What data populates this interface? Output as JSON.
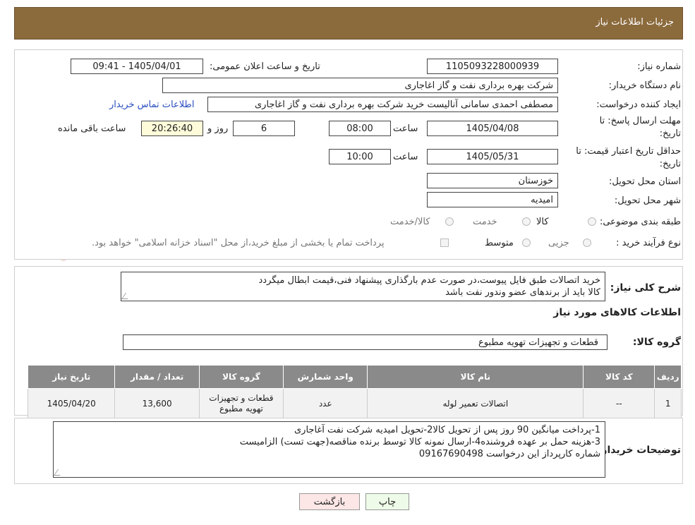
{
  "header": {
    "title": "جزئیات اطلاعات نیاز"
  },
  "form": {
    "need_number_label": "شماره نیاز:",
    "need_number": "1105093228000939",
    "announce_label": "تاریخ و ساعت اعلان عمومی:",
    "announce_value": "1405/04/01 - 09:41",
    "buyer_org_label": "نام دستگاه خریدار:",
    "buyer_org": "شرکت بهره برداری نفت و گاز اغاجاری",
    "creator_label": "ایجاد کننده درخواست:",
    "creator": "مصطفی احمدی سامانی آنالیست خرید شرکت بهره برداری نفت و گاز اغاجاری",
    "contact_link": "اطلاعات تماس خریدار",
    "deadline_label_1": "مهلت ارسال پاسخ: تا",
    "deadline_label_2": "تاریخ:",
    "deadline_date": "1405/04/08",
    "hour_label": "ساعت",
    "deadline_time": "08:00",
    "days": "6",
    "days_label": "روز و",
    "remaining": "20:26:40",
    "remaining_label": "ساعت باقی مانده",
    "validity_label_1": "حداقل تاریخ اعتبار قیمت: تا",
    "validity_label_2": "تاریخ:",
    "validity_date": "1405/05/31",
    "validity_time": "10:00",
    "province_label": "استان محل تحویل:",
    "province": "خوزستان",
    "city_label": "شهر محل تحویل:",
    "city": "امیدیه",
    "category_label": "طبقه بندی موضوعی:",
    "category_options": [
      "کالا",
      "خدمت",
      "کالا/خدمت"
    ],
    "process_label": "نوع فرآیند خرید :",
    "process_options": [
      "جزیی",
      "متوسط"
    ],
    "payment_note": "پرداخت تمام یا بخشی از مبلغ خرید،از محل \"اسناد خزانه اسلامی\" خواهد بود."
  },
  "description": {
    "label": "شرح کلی نیاز:",
    "lines": [
      "خرید اتصالات طبق فایل پیوست،در صورت عدم بارگذاری پیشنهاد فنی،قیمت ابطال میگردد",
      "کالا باید از برندهای عضو وندور نفت باشد"
    ]
  },
  "goods_info_title": "اطلاعات کالاهای مورد نیاز",
  "goods_group": {
    "label": "گروه کالا:",
    "value": "قطعات و تجهیزات تهویه مطبوع"
  },
  "table": {
    "headers": [
      "ردیف",
      "کد کالا",
      "نام کالا",
      "واحد شمارش",
      "گروه کالا",
      "تعداد / مقدار",
      "تاریخ نیاز"
    ],
    "rows": [
      {
        "row": "1",
        "code": "--",
        "name": "اتصالات تعمیر لوله",
        "unit": "عدد",
        "group": "قطعات و تجهیزات تهویه مطبوع",
        "qty": "13,600",
        "date": "1405/04/20"
      }
    ]
  },
  "buyer_notes": {
    "label": "توضیحات خریدار:",
    "lines": [
      "1-پرداخت میانگین 90 روز پس از تحویل کالا2-تحویل امیدیه شرکت نفت آغاجاری",
      "3-هزینه حمل بر عهده فروشنده4-ارسال نمونه کالا توسط برنده مناقصه(جهت تست) الزامیست",
      "شماره کارپرداز این درخواست 09167690498"
    ]
  },
  "buttons": {
    "print": "چاپ",
    "back": "بازگشت"
  },
  "watermark": "AriaTender.neT"
}
